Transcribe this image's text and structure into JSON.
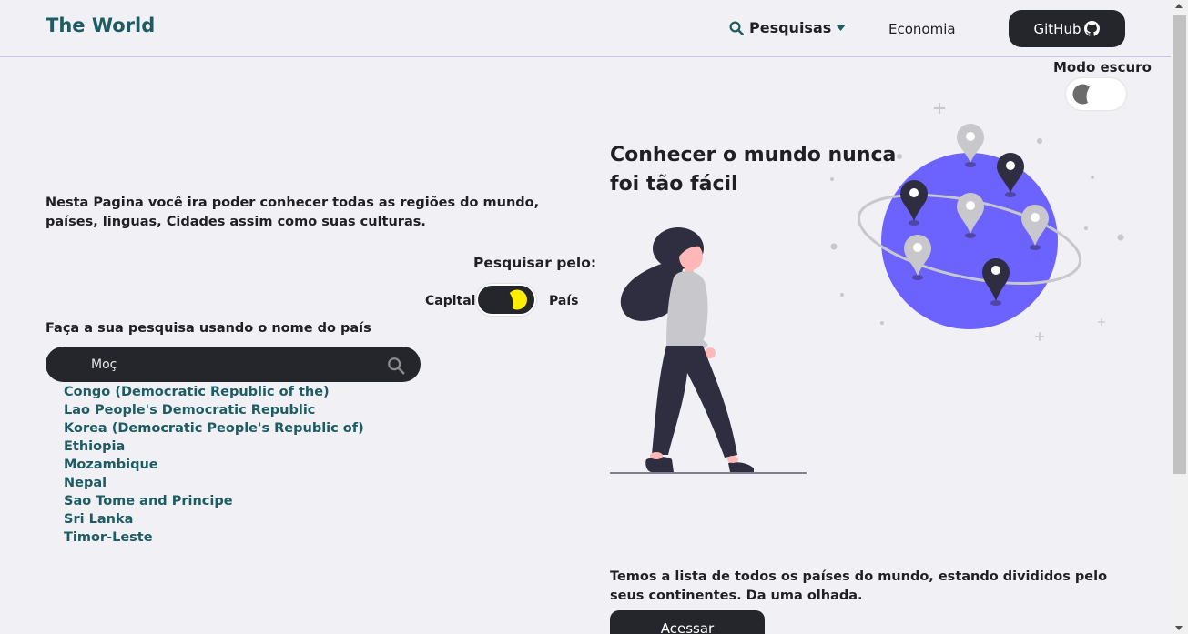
{
  "header": {
    "brand": "The World",
    "nav": {
      "search_label": "Pesquisas",
      "economy_label": "Economia",
      "github_label": "GitHub"
    }
  },
  "dark_mode": {
    "label": "Modo escuro"
  },
  "left": {
    "intro": "Nesta Pagina você ira poder conhecer todas as regiões do mundo, países, linguas, Cidades assim como suas culturas.",
    "search_by_label": "Pesquisar pelo:",
    "option_capital": "Capital",
    "option_country": "País",
    "search_help": "Faça a sua pesquisa usando o nome do país",
    "search_value": "Moç",
    "results": [
      "Congo (Democratic Republic of the)",
      "Lao People's Democratic Republic",
      "Korea (Democratic People's Republic of)",
      "Ethiopia",
      "Mozambique",
      "Nepal",
      "Sao Tome and Principe",
      "Sri Lanka",
      "Timor-Leste"
    ]
  },
  "right": {
    "hero_title": "Conhecer o mundo nunca foi tão fácil",
    "bottom_text": "Temos a lista de todos os países do mundo, estando divididos pelo seus continentes. Da uma olhada.",
    "access_label": "Acessar"
  },
  "colors": {
    "brand": "#1d5c63",
    "dark": "#24262b",
    "globe": "#6c63ff",
    "toggle_knob": "#ffee00"
  },
  "icons": [
    "search-icon",
    "caret-down-icon",
    "github-icon",
    "half-moon-icon"
  ]
}
